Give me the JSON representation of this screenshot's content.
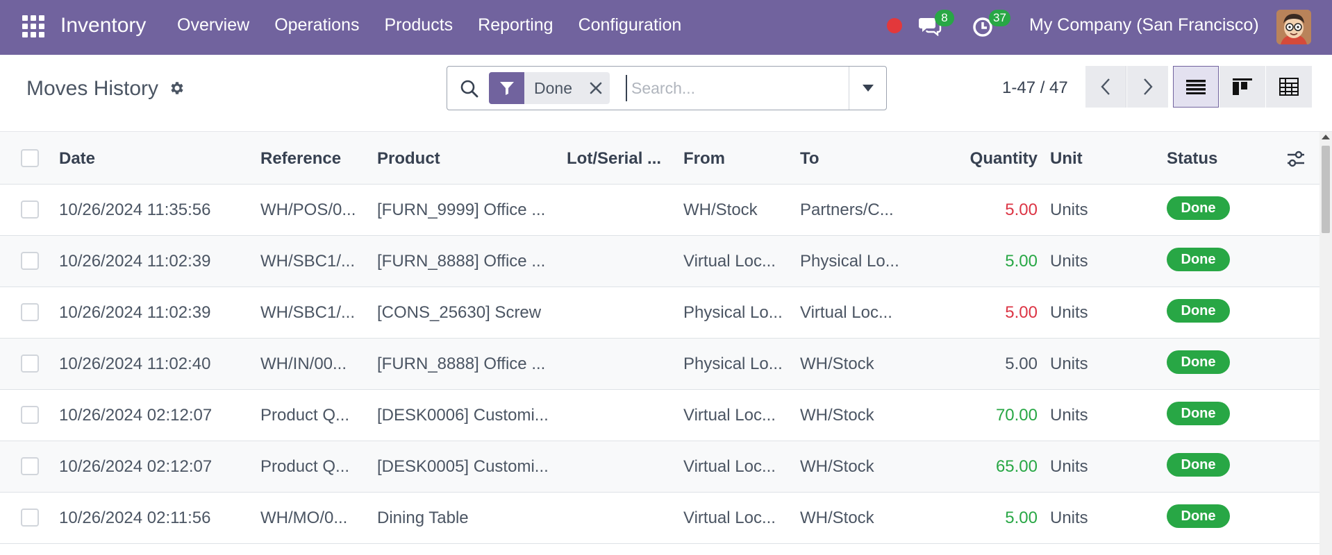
{
  "navbar": {
    "brand": "Inventory",
    "menu": [
      "Overview",
      "Operations",
      "Products",
      "Reporting",
      "Configuration"
    ],
    "messages_count": "8",
    "activities_count": "37",
    "company": "My Company (San Francisco)",
    "bg_color": "#71639e"
  },
  "control_panel": {
    "title": "Moves History",
    "filter_facet": "Done",
    "search_placeholder": "Search...",
    "pager": "1-47 / 47"
  },
  "table": {
    "headers": {
      "date": "Date",
      "reference": "Reference",
      "product": "Product",
      "lot": "Lot/Serial ...",
      "from": "From",
      "to": "To",
      "quantity": "Quantity",
      "unit": "Unit",
      "status": "Status"
    },
    "rows": [
      {
        "date": "10/26/2024 11:35:56",
        "reference": "WH/POS/0...",
        "product": "[FURN_9999] Office ...",
        "lot": "",
        "from": "WH/Stock",
        "to": "Partners/C...",
        "quantity": "5.00",
        "qty_color": "#dc3545",
        "unit": "Units",
        "status": "Done"
      },
      {
        "date": "10/26/2024 11:02:39",
        "reference": "WH/SBC1/...",
        "product": "[FURN_8888] Office ...",
        "lot": "",
        "from": "Virtual Loc...",
        "to": "Physical Lo...",
        "quantity": "5.00",
        "qty_color": "#28a745",
        "unit": "Units",
        "status": "Done"
      },
      {
        "date": "10/26/2024 11:02:39",
        "reference": "WH/SBC1/...",
        "product": "[CONS_25630] Screw",
        "lot": "",
        "from": "Physical Lo...",
        "to": "Virtual Loc...",
        "quantity": "5.00",
        "qty_color": "#dc3545",
        "unit": "Units",
        "status": "Done"
      },
      {
        "date": "10/26/2024 11:02:40",
        "reference": "WH/IN/00...",
        "product": "[FURN_8888] Office ...",
        "lot": "",
        "from": "Physical Lo...",
        "to": "WH/Stock",
        "quantity": "5.00",
        "qty_color": "#4b5563",
        "unit": "Units",
        "status": "Done"
      },
      {
        "date": "10/26/2024 02:12:07",
        "reference": "Product Q...",
        "product": "[DESK0006] Customi...",
        "lot": "",
        "from": "Virtual Loc...",
        "to": "WH/Stock",
        "quantity": "70.00",
        "qty_color": "#28a745",
        "unit": "Units",
        "status": "Done"
      },
      {
        "date": "10/26/2024 02:12:07",
        "reference": "Product Q...",
        "product": "[DESK0005] Customi...",
        "lot": "",
        "from": "Virtual Loc...",
        "to": "WH/Stock",
        "quantity": "65.00",
        "qty_color": "#28a745",
        "unit": "Units",
        "status": "Done"
      },
      {
        "date": "10/26/2024 02:11:56",
        "reference": "WH/MO/0...",
        "product": "Dining Table",
        "lot": "",
        "from": "Virtual Loc...",
        "to": "WH/Stock",
        "quantity": "5.00",
        "qty_color": "#28a745",
        "unit": "Units",
        "status": "Done"
      }
    ]
  }
}
